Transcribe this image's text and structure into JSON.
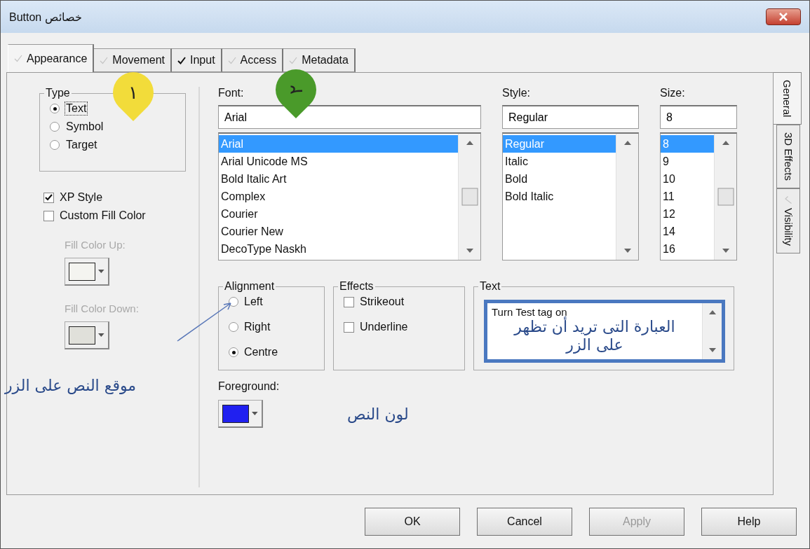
{
  "window": {
    "title": "خصائص Button"
  },
  "tabs": [
    {
      "label": "Appearance",
      "selected": true,
      "checked": false
    },
    {
      "label": "Movement",
      "selected": false,
      "checked": false
    },
    {
      "label": "Input",
      "selected": false,
      "checked": true
    },
    {
      "label": "Access",
      "selected": false,
      "checked": false
    },
    {
      "label": "Metadata",
      "selected": false,
      "checked": false
    }
  ],
  "side_tabs": [
    {
      "label": "General",
      "selected": true,
      "has_check": false
    },
    {
      "label": "3D Effects",
      "selected": false,
      "has_check": false
    },
    {
      "label": "Visibility",
      "selected": false,
      "has_check": true
    }
  ],
  "type_group": {
    "title": "Type",
    "options": [
      {
        "label": "Text",
        "selected": true
      },
      {
        "label": "Symbol",
        "selected": false
      },
      {
        "label": "Target",
        "selected": false
      }
    ]
  },
  "checkboxes": [
    {
      "label": "XP Style",
      "checked": true
    },
    {
      "label": "Custom Fill Color",
      "checked": false
    }
  ],
  "fill_colors": [
    {
      "label": "Fill Color Up:",
      "color": "#f4f4f0",
      "disabled": true
    },
    {
      "label": "Fill Color Down:",
      "color": "#e0e0da",
      "disabled": true
    }
  ],
  "font": {
    "label": "Font:",
    "value": "Arial",
    "items": [
      {
        "label": "Arial",
        "selected": true
      },
      {
        "label": "Arial Unicode MS",
        "selected": false
      },
      {
        "label": "Bold Italic Art",
        "selected": false
      },
      {
        "label": "Complex",
        "selected": false
      },
      {
        "label": "Courier",
        "selected": false
      },
      {
        "label": "Courier New",
        "selected": false
      },
      {
        "label": "DecoType Naskh",
        "selected": false
      }
    ]
  },
  "style": {
    "label": "Style:",
    "value": "Regular",
    "items": [
      {
        "label": "Regular",
        "selected": true
      },
      {
        "label": "Italic",
        "selected": false
      },
      {
        "label": "Bold",
        "selected": false
      },
      {
        "label": "Bold Italic",
        "selected": false
      }
    ]
  },
  "size": {
    "label": "Size:",
    "value": "8",
    "items": [
      {
        "label": "8",
        "selected": true
      },
      {
        "label": "9",
        "selected": false
      },
      {
        "label": "10",
        "selected": false
      },
      {
        "label": "11",
        "selected": false
      },
      {
        "label": "12",
        "selected": false
      },
      {
        "label": "14",
        "selected": false
      },
      {
        "label": "16",
        "selected": false
      }
    ]
  },
  "alignment": {
    "title": "Alignment",
    "options": [
      {
        "label": "Left",
        "selected": false
      },
      {
        "label": "Right",
        "selected": false
      },
      {
        "label": "Centre",
        "selected": true
      }
    ]
  },
  "effects": {
    "title": "Effects",
    "options": [
      {
        "label": "Strikeout",
        "checked": false
      },
      {
        "label": "Underline",
        "checked": false
      }
    ]
  },
  "text_group": {
    "title": "Text",
    "value": "Turn Test tag on"
  },
  "foreground": {
    "label": "Foreground:",
    "color": "#2020f0"
  },
  "annotations": {
    "badges": [
      {
        "label": "١",
        "color": "#f2dc3a"
      },
      {
        "label": "٢",
        "color": "#4a9a2a"
      }
    ],
    "text_note": "العبارة التى تريد أن تظهر على الزر",
    "alignment_note": "موقع النص على الزر",
    "color_note": "لون النص"
  },
  "buttons": [
    {
      "label": "OK",
      "disabled": false
    },
    {
      "label": "Cancel",
      "disabled": false
    },
    {
      "label": "Apply",
      "disabled": true
    },
    {
      "label": "Help",
      "disabled": false
    }
  ]
}
